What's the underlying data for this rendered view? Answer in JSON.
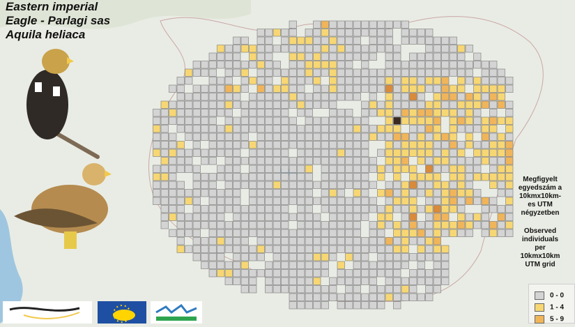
{
  "title": {
    "line1": "Eastern imperial",
    "line2": "Eagle - Parlagi sas",
    "line3": "Aquila heliaca"
  },
  "legend": {
    "hu_text": [
      "Megfigyelt",
      "egyedszám a",
      "10kmx10km-",
      "es UTM",
      "négyzetben"
    ],
    "en_text": [
      "Observed",
      "individuals",
      "per",
      "10kmx10km",
      "UTM grid"
    ],
    "classes": [
      {
        "label": "0 - 0",
        "color": "#d4d4d4"
      },
      {
        "label": "1 - 4",
        "color": "#f7d774"
      },
      {
        "label": "5 - 9",
        "color": "#f0b55a"
      }
    ]
  },
  "colors": {
    "cell_empty": "#d4d4d4",
    "cell_low": "#f7d774",
    "cell_mid": "#f0b55a",
    "cell_high": "#d98a3a",
    "cell_max": "#3a2a22",
    "land": "#e9ece4",
    "water": "#9fc6e0"
  },
  "icons": [
    "eagle-adult-illustration",
    "eagle-juvenile-illustration",
    "bird-logo",
    "eu-life-logo",
    "birds-logo"
  ]
}
